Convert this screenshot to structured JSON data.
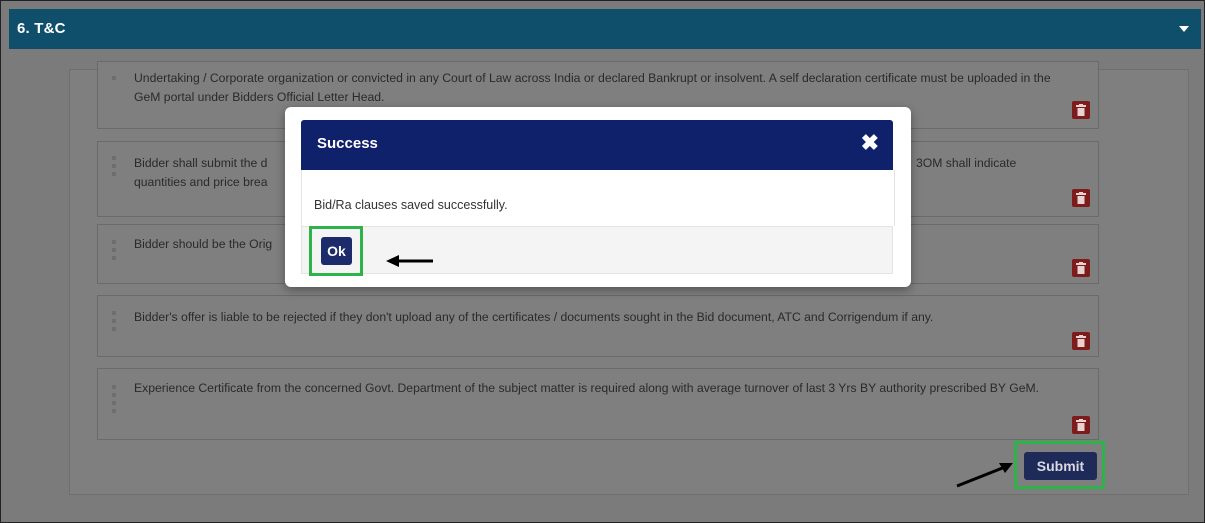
{
  "section": {
    "title": "6. T&C",
    "toggle_icon": "caret-down-icon"
  },
  "clauses": [
    {
      "text": "Undertaking / Corporate organization or convicted in any Court of Law across India or declared Bankrupt or insolvent. A self declaration certificate must be uploaded in the GeM portal under Bidders Official Letter Head."
    },
    {
      "text_left": "Bidder shall submit the d",
      "text_right": "3OM shall indicate",
      "text_line2": "quantities and price brea"
    },
    {
      "text": "Bidder should be the Orig"
    },
    {
      "text": "Bidder's offer is liable to be rejected if they don't upload any of the certificates / documents sought in the Bid document, ATC and Corrigendum if any."
    },
    {
      "text": "Experience Certificate from the concerned Govt. Department of the subject matter is required along with average turnover of last 3 Yrs BY authority prescribed BY GeM."
    }
  ],
  "submit_label": "Submit",
  "modal": {
    "title": "Success",
    "close_symbol": "✖",
    "message": "Bid/Ra clauses saved successfully.",
    "ok_label": "Ok"
  },
  "colors": {
    "header": "#0f4f6b",
    "modal_header": "#10216b",
    "button": "#1d2b6a",
    "delete": "#7e1c1c",
    "highlight": "#2db34a",
    "overlay": "#7b7b7b"
  }
}
